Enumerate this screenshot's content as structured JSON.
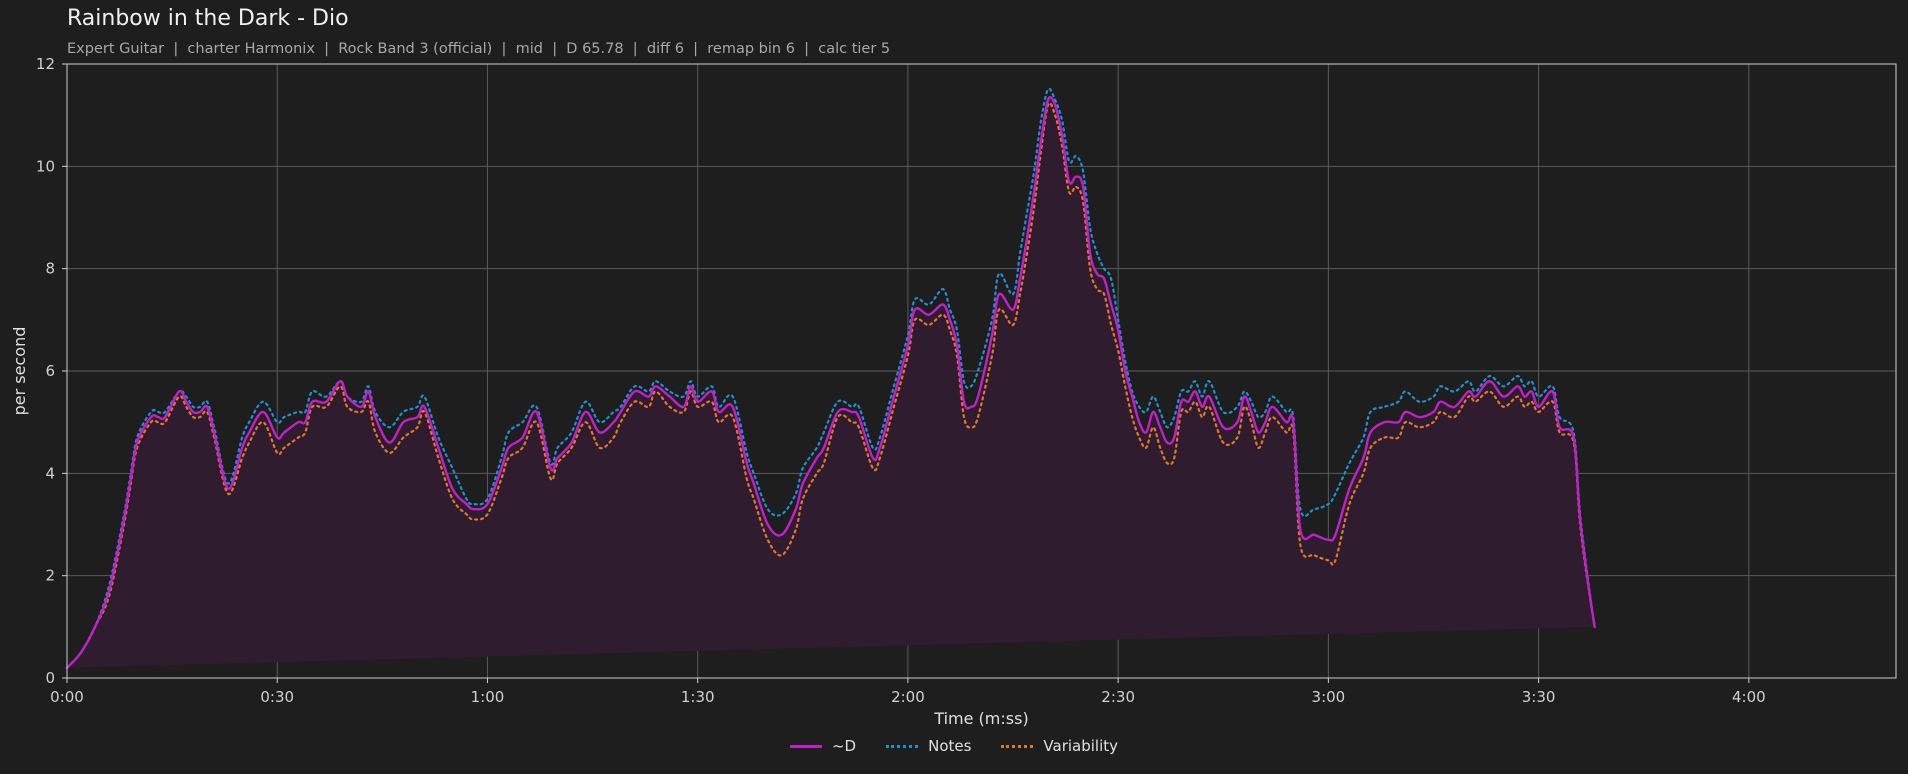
{
  "header": {
    "title": "Rainbow in the Dark - Dio",
    "subtitle": "Expert Guitar  |  charter Harmonix  |  Rock Band 3 (official)  |  mid  |  D 65.78  |  diff 6  |  remap bin 6  |  calc tier 5"
  },
  "colors": {
    "background": "#1e1e1e",
    "d_line": "#c020c8",
    "d_fill": "#2f1c2f",
    "notes": "#1f8fd0",
    "variability": "#e0782a",
    "grid": "#5a5a5a",
    "axis": "#cfcfcf"
  },
  "chart_data": {
    "type": "line",
    "xlabel": "Time (m:ss)",
    "ylabel": "per second",
    "xlim": [
      0,
      261
    ],
    "ylim": [
      0,
      12
    ],
    "x_ticks": [
      0,
      30,
      60,
      90,
      120,
      150,
      180,
      210,
      240
    ],
    "x_tick_labels": [
      "0:00",
      "0:30",
      "1:00",
      "1:30",
      "2:00",
      "2:30",
      "3:00",
      "3:30",
      "4:00"
    ],
    "y_ticks": [
      0,
      2,
      4,
      6,
      8,
      10,
      12
    ],
    "y_tick_labels": [
      "0",
      "2",
      "4",
      "6",
      "8",
      "10",
      "12"
    ],
    "grid": true,
    "legend_position": "bottom-center",
    "x": [
      0,
      2,
      4,
      6,
      8,
      9,
      10,
      12,
      13,
      14,
      16,
      17,
      18,
      19,
      20,
      21,
      23,
      25,
      26,
      28,
      30,
      31,
      33,
      34,
      35,
      37,
      39,
      40,
      42,
      43,
      44,
      46,
      48,
      50,
      51,
      53,
      55,
      57,
      58,
      60,
      62,
      63,
      65,
      67,
      69,
      70,
      72,
      74,
      76,
      78,
      79,
      81,
      83,
      84,
      86,
      88,
      89,
      90,
      92,
      93,
      95,
      97,
      98,
      100,
      102,
      104,
      105,
      107,
      108,
      110,
      112,
      113,
      115,
      116,
      118,
      120,
      121,
      123,
      125,
      126,
      127,
      128,
      129,
      130,
      132,
      133,
      135,
      136,
      137,
      138,
      139,
      140,
      141,
      142,
      143,
      144,
      145,
      146,
      147,
      148,
      149,
      150,
      151,
      152,
      153,
      154,
      155,
      156,
      157,
      158,
      159,
      160,
      161,
      162,
      163,
      165,
      167,
      168,
      169,
      170,
      171,
      172,
      174,
      175,
      176,
      178,
      180,
      181,
      183,
      185,
      186,
      188,
      190,
      191,
      193,
      195,
      196,
      198,
      200,
      201,
      203,
      205,
      207,
      208,
      209,
      210,
      212,
      213,
      215,
      216,
      218,
      219,
      221,
      222,
      224,
      225,
      227,
      228,
      230,
      231,
      233,
      234,
      236,
      237,
      239,
      240,
      242,
      244,
      245,
      247,
      249,
      250,
      252,
      254,
      256,
      258,
      259,
      260,
      261
    ],
    "series": [
      {
        "name": "~D",
        "style": "solid",
        "values": [
          0.2,
          0.5,
          1.0,
          1.7,
          3.0,
          3.8,
          4.6,
          5.1,
          5.1,
          5.1,
          5.6,
          5.4,
          5.2,
          5.2,
          5.3,
          4.8,
          3.7,
          4.5,
          4.8,
          5.2,
          4.7,
          4.8,
          5.0,
          5.0,
          5.4,
          5.4,
          5.8,
          5.5,
          5.3,
          5.6,
          5.1,
          4.6,
          5.0,
          5.1,
          5.3,
          4.5,
          3.7,
          3.4,
          3.3,
          3.4,
          4.1,
          4.5,
          4.7,
          5.2,
          4.1,
          4.3,
          4.6,
          5.2,
          4.8,
          5.0,
          5.2,
          5.6,
          5.5,
          5.7,
          5.5,
          5.3,
          5.7,
          5.4,
          5.6,
          5.2,
          5.3,
          4.2,
          3.8,
          3.0,
          2.8,
          3.3,
          3.8,
          4.3,
          4.5,
          5.2,
          5.2,
          5.1,
          4.3,
          4.5,
          5.5,
          6.5,
          7.2,
          7.1,
          7.3,
          7.0,
          6.5,
          5.4,
          5.3,
          5.5,
          6.7,
          7.5,
          7.2,
          7.8,
          8.6,
          9.5,
          10.5,
          11.3,
          11.2,
          10.6,
          9.7,
          9.8,
          9.6,
          8.3,
          7.9,
          7.8,
          7.3,
          6.8,
          6.0,
          5.5,
          5.0,
          4.8,
          5.2,
          4.9,
          4.6,
          4.7,
          5.4,
          5.4,
          5.6,
          5.3,
          5.5,
          4.9,
          5.0,
          5.5,
          5.2,
          4.8,
          5.0,
          5.3,
          5.0,
          5.0,
          2.9,
          2.8,
          2.7,
          2.8,
          3.7,
          4.3,
          4.8,
          5.0,
          5.0,
          5.2,
          5.1,
          5.2,
          5.4,
          5.3,
          5.6,
          5.5,
          5.8,
          5.5,
          5.7,
          5.5,
          5.6,
          5.3,
          5.6,
          4.9,
          4.7,
          3.0,
          1.0,
          0.5
        ]
      },
      {
        "name": "Notes",
        "style": "dotted",
        "values": [
          0.2,
          0.5,
          1.0,
          1.8,
          3.1,
          3.9,
          4.7,
          5.2,
          5.2,
          5.2,
          5.6,
          5.5,
          5.3,
          5.3,
          5.4,
          4.9,
          3.8,
          4.7,
          5.0,
          5.4,
          5.0,
          5.1,
          5.2,
          5.2,
          5.6,
          5.5,
          5.8,
          5.5,
          5.4,
          5.7,
          5.2,
          4.9,
          5.2,
          5.3,
          5.5,
          4.7,
          4.1,
          3.5,
          3.4,
          3.5,
          4.3,
          4.8,
          5.0,
          5.3,
          4.2,
          4.5,
          4.8,
          5.4,
          5.0,
          5.2,
          5.3,
          5.7,
          5.6,
          5.8,
          5.6,
          5.5,
          5.8,
          5.5,
          5.7,
          5.3,
          5.5,
          4.4,
          4.0,
          3.3,
          3.2,
          3.6,
          4.1,
          4.5,
          4.8,
          5.4,
          5.3,
          5.3,
          4.5,
          4.7,
          5.7,
          6.7,
          7.4,
          7.3,
          7.6,
          7.2,
          6.8,
          5.8,
          5.7,
          6.0,
          7.0,
          7.9,
          7.5,
          8.3,
          9.1,
          9.9,
          10.9,
          11.5,
          11.3,
          10.9,
          10.1,
          10.2,
          9.9,
          8.8,
          8.3,
          8.0,
          7.8,
          7.0,
          6.2,
          5.6,
          5.3,
          5.2,
          5.5,
          5.2,
          4.9,
          5.1,
          5.6,
          5.6,
          5.8,
          5.5,
          5.8,
          5.2,
          5.3,
          5.6,
          5.4,
          5.1,
          5.2,
          5.5,
          5.2,
          5.1,
          3.3,
          3.3,
          3.4,
          3.6,
          4.2,
          4.7,
          5.2,
          5.3,
          5.4,
          5.6,
          5.4,
          5.5,
          5.7,
          5.6,
          5.8,
          5.6,
          5.9,
          5.7,
          5.9,
          5.7,
          5.8,
          5.5,
          5.7,
          5.1,
          4.8,
          3.1,
          1.0,
          0.5
        ]
      },
      {
        "name": "Variability",
        "style": "dotted",
        "values": [
          0.2,
          0.5,
          1.0,
          1.6,
          2.9,
          3.7,
          4.5,
          5.0,
          5.0,
          5.0,
          5.5,
          5.3,
          5.1,
          5.1,
          5.2,
          4.7,
          3.6,
          4.3,
          4.6,
          5.0,
          4.4,
          4.5,
          4.7,
          4.8,
          5.3,
          5.3,
          5.7,
          5.3,
          5.2,
          5.4,
          4.8,
          4.4,
          4.7,
          4.9,
          5.2,
          4.3,
          3.5,
          3.2,
          3.1,
          3.2,
          3.9,
          4.3,
          4.5,
          5.0,
          3.9,
          4.2,
          4.5,
          5.0,
          4.5,
          4.7,
          5.0,
          5.4,
          5.3,
          5.6,
          5.3,
          5.2,
          5.6,
          5.3,
          5.4,
          5.0,
          5.1,
          3.9,
          3.5,
          2.7,
          2.4,
          2.9,
          3.5,
          4.0,
          4.2,
          5.1,
          5.0,
          4.9,
          4.1,
          4.3,
          5.3,
          6.3,
          7.0,
          6.9,
          7.1,
          6.8,
          6.3,
          5.1,
          4.9,
          5.1,
          6.3,
          7.2,
          6.9,
          7.5,
          8.3,
          9.2,
          10.3,
          11.2,
          11.0,
          10.4,
          9.5,
          9.6,
          9.3,
          8.0,
          7.6,
          7.5,
          6.9,
          6.4,
          5.7,
          5.1,
          4.7,
          4.5,
          4.9,
          4.5,
          4.2,
          4.3,
          5.2,
          5.2,
          5.4,
          5.1,
          5.3,
          4.6,
          4.7,
          5.3,
          5.0,
          4.5,
          4.8,
          5.1,
          4.8,
          4.8,
          2.6,
          2.4,
          2.3,
          2.3,
          3.4,
          4.0,
          4.5,
          4.7,
          4.7,
          5.0,
          4.9,
          5.0,
          5.2,
          5.1,
          5.5,
          5.4,
          5.6,
          5.3,
          5.5,
          5.3,
          5.4,
          5.2,
          5.4,
          4.8,
          4.6,
          2.9,
          1.0,
          0.5
        ]
      }
    ]
  }
}
